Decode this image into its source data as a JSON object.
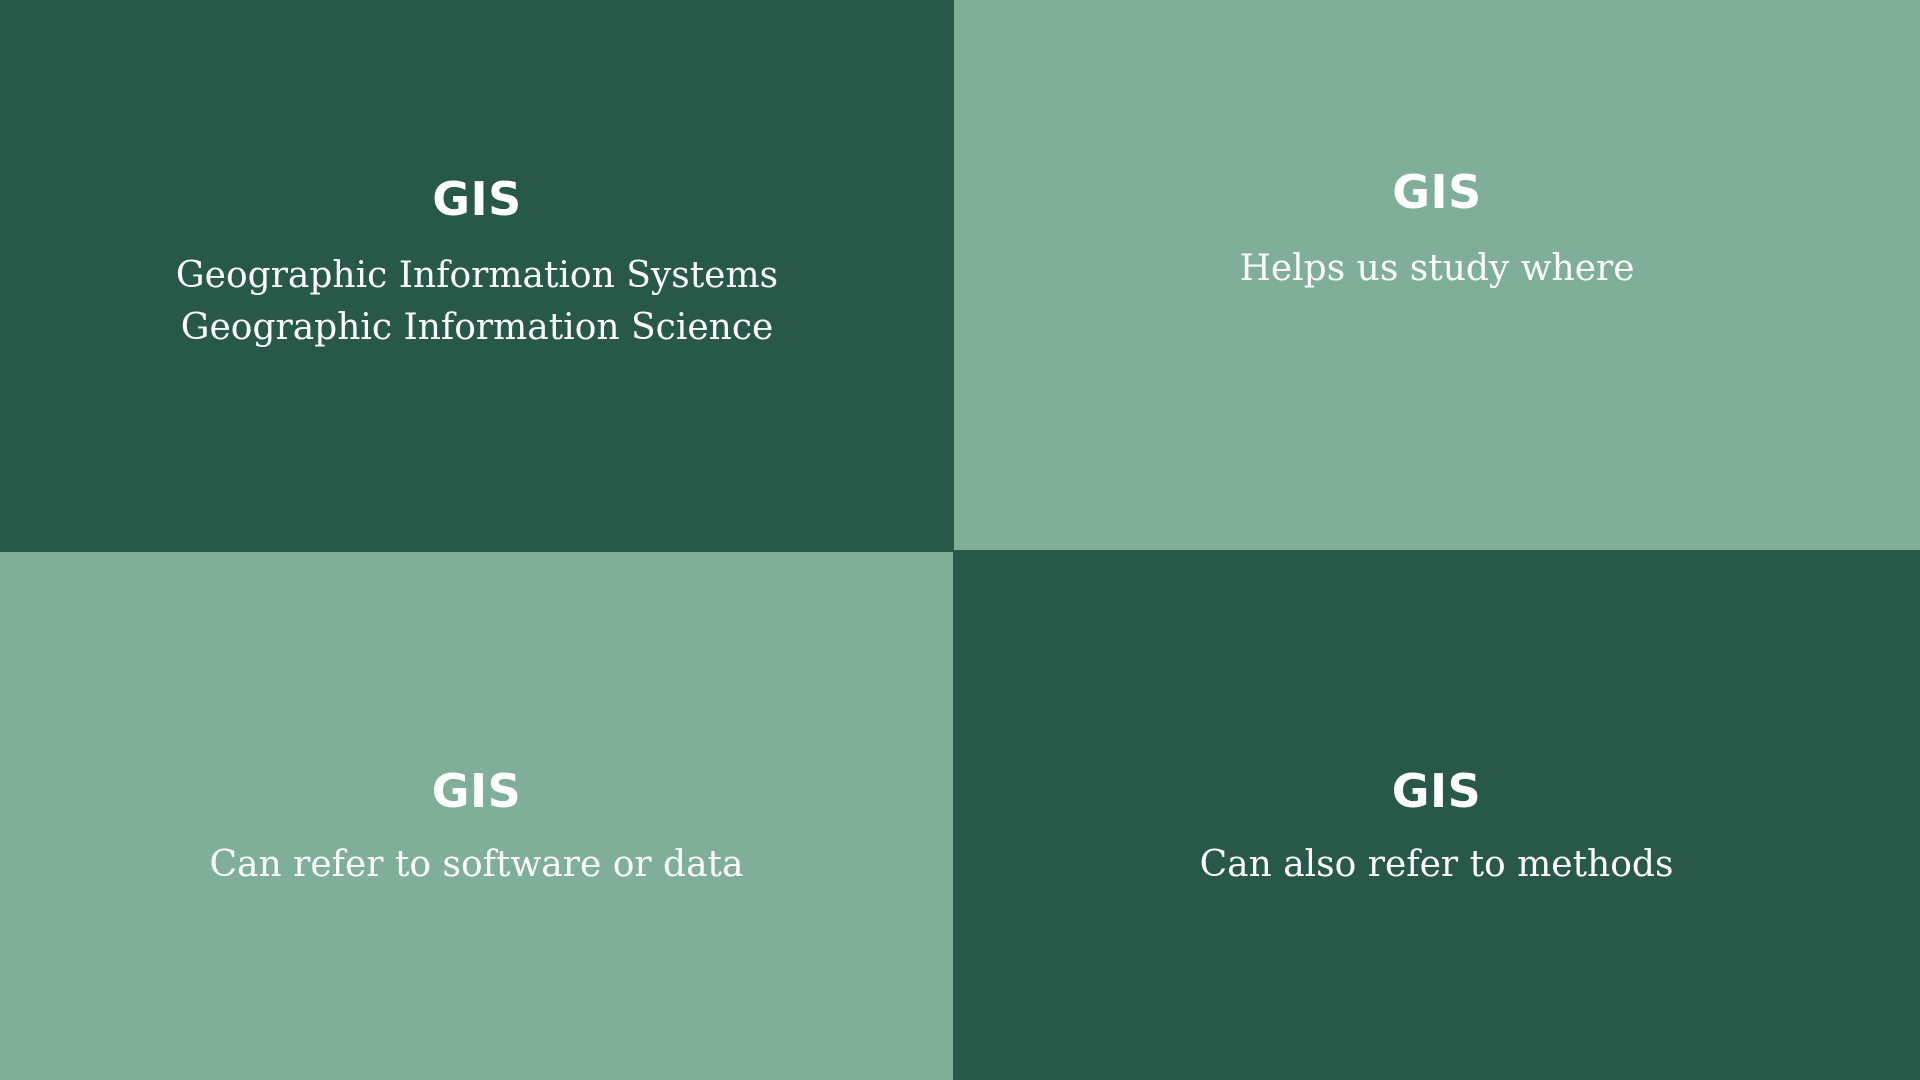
{
  "colors": {
    "dark_panel": "#275848",
    "light_panel": "#7fae99",
    "text": "#ffffff"
  },
  "panels": [
    {
      "heading": "GIS",
      "lines": [
        "Geographic Information Systems",
        "Geographic Information Science"
      ]
    },
    {
      "heading": "GIS",
      "lines": [
        "Helps us study where"
      ]
    },
    {
      "heading": "GIS",
      "lines": [
        "Can refer to software or data"
      ]
    },
    {
      "heading": "GIS",
      "lines": [
        "Can also refer to methods"
      ]
    }
  ]
}
